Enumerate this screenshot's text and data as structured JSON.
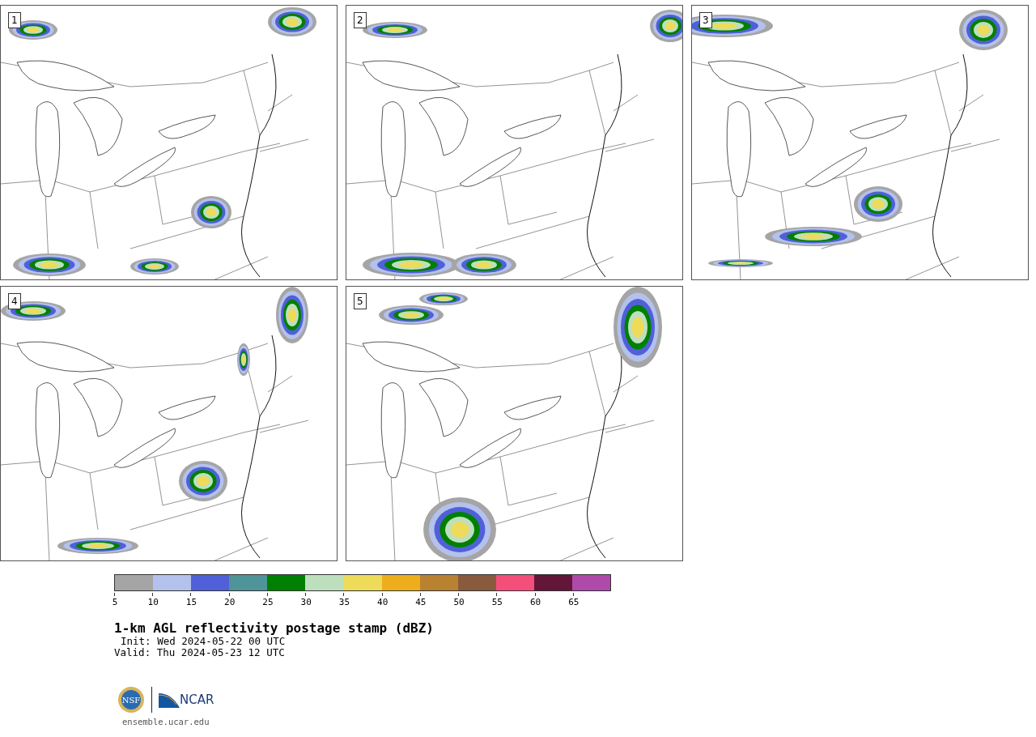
{
  "panels": [
    {
      "label": "1"
    },
    {
      "label": "2"
    },
    {
      "label": "3"
    },
    {
      "label": "4"
    },
    {
      "label": "5"
    }
  ],
  "colorbar": {
    "segments": [
      {
        "color": "#a5a5a5"
      },
      {
        "color": "#b4c1ec"
      },
      {
        "color": "#5060d8"
      },
      {
        "color": "#4f9499"
      },
      {
        "color": "#008000"
      },
      {
        "color": "#bedfbe"
      },
      {
        "color": "#eedb5a"
      },
      {
        "color": "#eeae1b"
      },
      {
        "color": "#b98231"
      },
      {
        "color": "#8a5a3d"
      },
      {
        "color": "#f44f7b"
      },
      {
        "color": "#621638"
      },
      {
        "color": "#ae4aa9"
      }
    ],
    "ticks": [
      "5",
      "10",
      "15",
      "20",
      "25",
      "30",
      "35",
      "40",
      "45",
      "50",
      "55",
      "60",
      "65"
    ]
  },
  "title": "1-km AGL reflectivity postage stamp (dBZ)",
  "init": "Init: Wed 2024-05-22 00 UTC",
  "valid": "Valid: Thu 2024-05-23 12 UTC",
  "logos": {
    "nsf": "NSF",
    "ncar": "NCAR"
  },
  "footer": "ensemble.ucar.edu"
}
